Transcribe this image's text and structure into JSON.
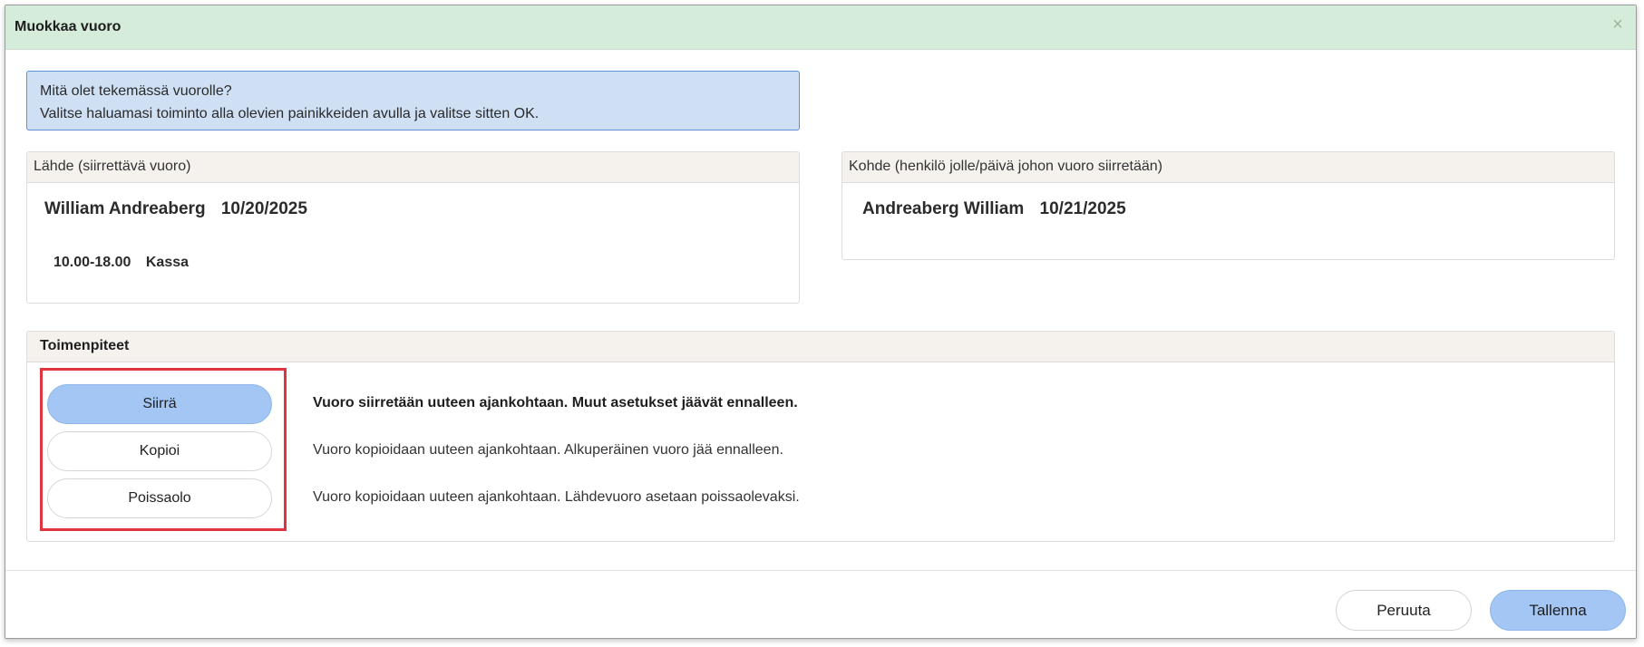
{
  "dialog": {
    "title": "Muokkaa vuoro",
    "close_icon": "close-icon",
    "close_glyph": "×"
  },
  "info": {
    "line1": "Mitä olet tekemässä vuorolle?",
    "line2": "Valitse haluamasi toiminto alla olevien painikkeiden avulla ja valitse sitten OK."
  },
  "source": {
    "header": "Lähde (siirrettävä vuoro)",
    "person": "William Andreaberg",
    "date": "10/20/2025",
    "shift_time": "10.00-18.00",
    "shift_place": "Kassa"
  },
  "target": {
    "header": "Kohde (henkilö jolle/päivä johon vuoro siirretään)",
    "person": "Andreaberg William",
    "date": "10/21/2025"
  },
  "actions": {
    "header": "Toimenpiteet",
    "selected": "Siirrä",
    "options": [
      {
        "label": "Siirrä",
        "description": "Vuoro siirretään uuteen ajankohtaan. Muut asetukset jäävät ennalleen."
      },
      {
        "label": "Kopioi",
        "description": "Vuoro kopioidaan uuteen ajankohtaan. Alkuperäinen vuoro jää ennalleen."
      },
      {
        "label": "Poissaolo",
        "description": "Vuoro kopioidaan uuteen ajankohtaan. Lähdevuoro asetaan poissaolevaksi."
      }
    ]
  },
  "footer": {
    "cancel_label": "Peruuta",
    "save_label": "Tallenna"
  },
  "colors": {
    "titlebar": "#d4ecd9",
    "info_background": "#cfe0f5",
    "info_border": "#5b8fd6",
    "primary_button": "#a3c6f4",
    "highlight": "#e0353f"
  }
}
